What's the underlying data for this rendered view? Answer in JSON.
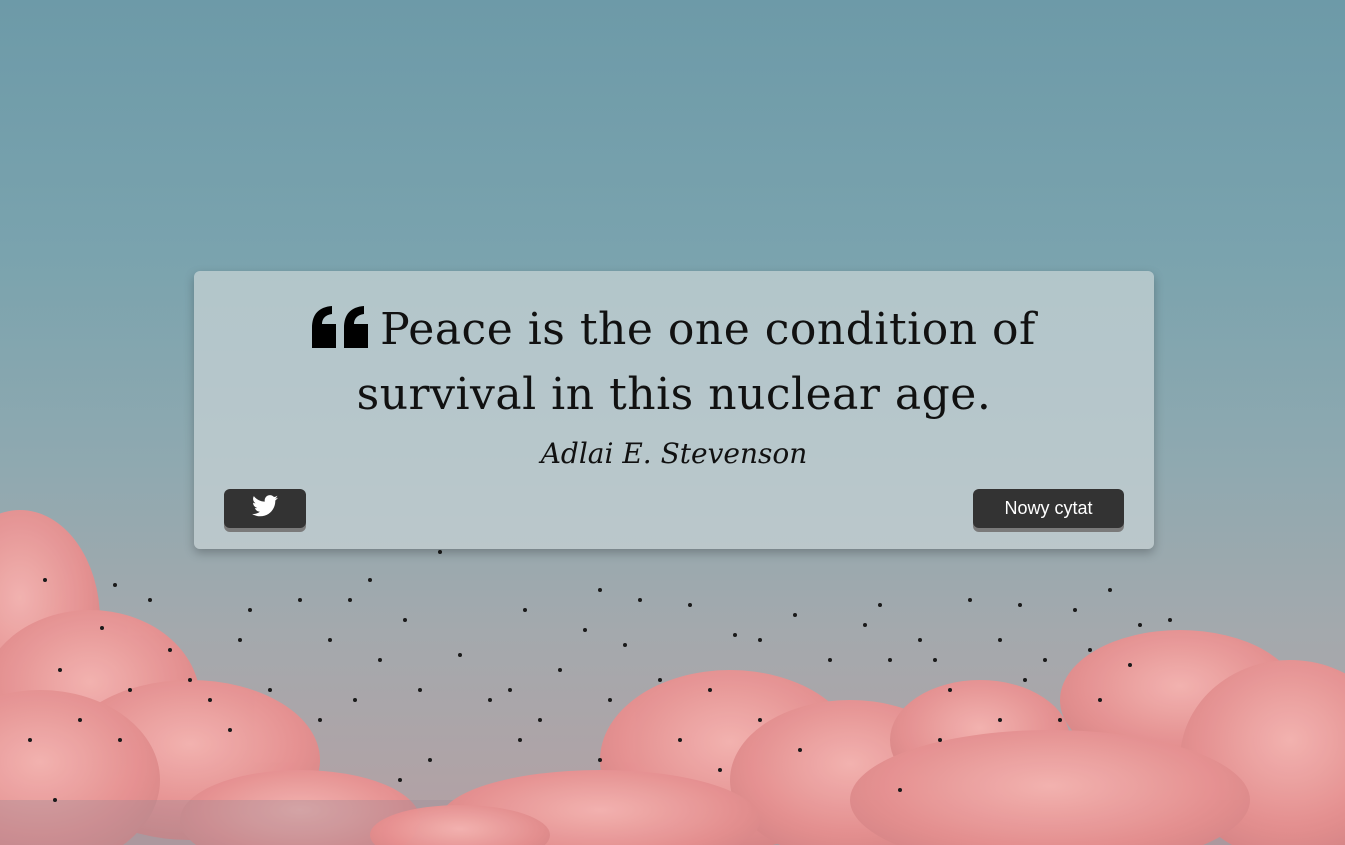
{
  "quote": {
    "text": "Peace is the one condition of survival in this nuclear age.",
    "author": "Adlai E. Stevenson"
  },
  "buttons": {
    "tweet_icon": "twitter-icon",
    "new_quote_label": "Nowy cytat"
  },
  "colors": {
    "button_bg": "#333333",
    "button_text": "#ffffff",
    "quote_text": "#111111",
    "card_bg": "rgba(200,210,213,0.72)"
  },
  "icons": {
    "quote_mark": "left-quote-icon",
    "tweet": "twitter-icon"
  }
}
